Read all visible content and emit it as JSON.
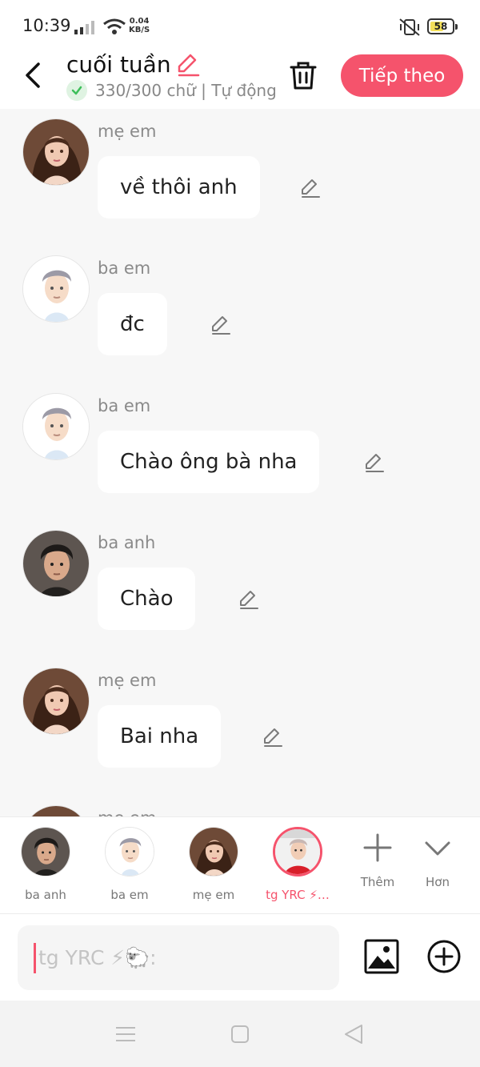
{
  "status_bar": {
    "time": "10:39",
    "net_speed_value": "0.04",
    "net_speed_unit": "KB/S",
    "battery": "58"
  },
  "header": {
    "title": "cuối tuần",
    "word_count": "330/300 chữ | Tự động",
    "next_label": "Tiếp theo"
  },
  "messages": [
    {
      "sender": "mẹ em",
      "text": "về thôi anh"
    },
    {
      "sender": "ba em",
      "text": "đc"
    },
    {
      "sender": "ba em",
      "text": "Chào ông bà nha"
    },
    {
      "sender": "ba anh",
      "text": "Chào"
    },
    {
      "sender": "mẹ em",
      "text": "Bai nha"
    },
    {
      "sender": "mẹ em",
      "text": ""
    }
  ],
  "characters": [
    {
      "label": "ba anh"
    },
    {
      "label": "ba em"
    },
    {
      "label": "mẹ em"
    },
    {
      "label": "tg YRC ⚡…"
    }
  ],
  "actions": {
    "add_label": "Thêm",
    "more_label": "Hơn"
  },
  "input": {
    "placeholder": "tg YRC ⚡🐑:"
  },
  "colors": {
    "accent": "#f5536c",
    "check_green": "#3dbf5a",
    "background": "#f7f7f7"
  }
}
